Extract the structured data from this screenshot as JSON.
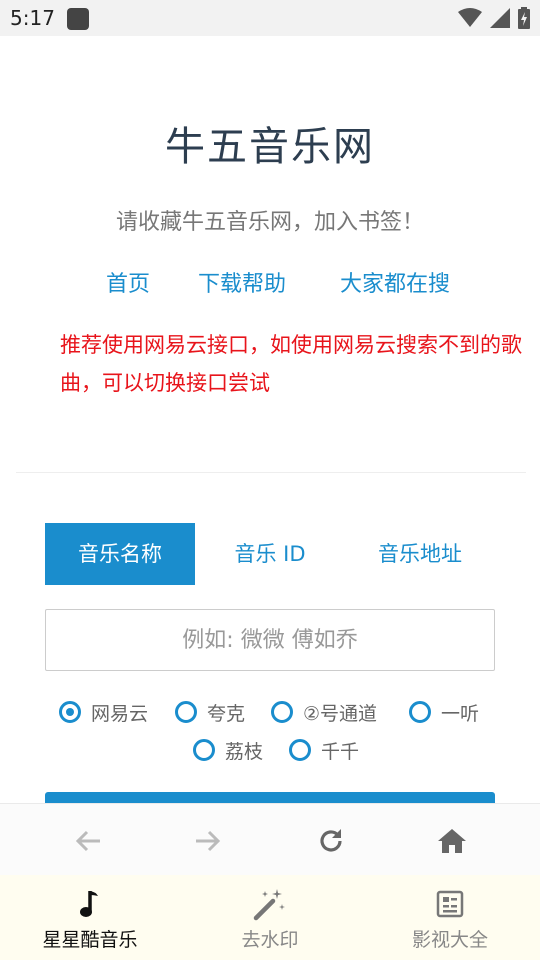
{
  "status": {
    "time": "5:17"
  },
  "page": {
    "title": "牛五音乐网",
    "subtitle": "请收藏牛五音乐网，加入书签！",
    "nav": [
      {
        "label": "首页"
      },
      {
        "label": "下载帮助"
      },
      {
        "label": "大家都在搜"
      }
    ],
    "notice": "推荐使用网易云接口，如使用网易云搜索不到的歌曲，可以切换接口尝试"
  },
  "tabs": [
    {
      "label": "音乐名称",
      "active": true
    },
    {
      "label": "音乐 ID",
      "active": false
    },
    {
      "label": "音乐地址",
      "active": false
    }
  ],
  "search": {
    "placeholder": "例如: 微微 傅如乔",
    "value": ""
  },
  "sources": [
    {
      "label": "网易云",
      "checked": true
    },
    {
      "label": "夸克",
      "checked": false
    },
    {
      "label": "②号通道",
      "checked": false
    },
    {
      "label": "一听",
      "checked": false
    },
    {
      "label": "荔枝",
      "checked": false
    },
    {
      "label": "千千",
      "checked": false
    }
  ],
  "bottom_tabs": [
    {
      "label": "星星酷音乐",
      "icon": "music-note-icon",
      "active": true
    },
    {
      "label": "去水印",
      "icon": "magic-wand-icon",
      "active": false
    },
    {
      "label": "影视大全",
      "icon": "video-list-icon",
      "active": false
    }
  ],
  "colors": {
    "accent": "#1a8dcd",
    "notice": "#e8141b",
    "title": "#2d3e50",
    "bottom_bar_bg": "#fffdf0"
  }
}
